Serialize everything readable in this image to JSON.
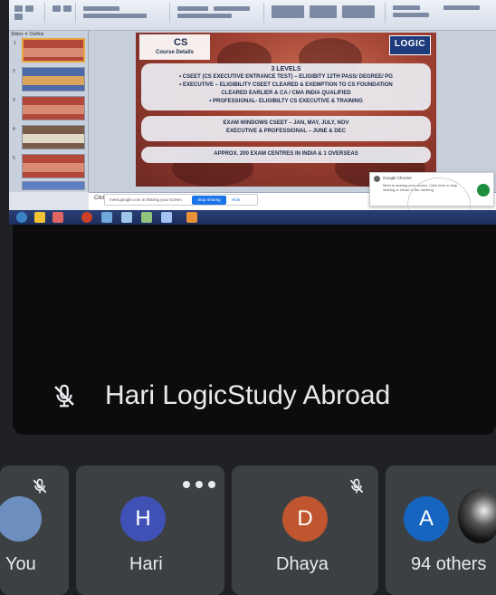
{
  "app": "Google Meet",
  "shared_screen": {
    "slide": {
      "title": "CS",
      "subtitle": "Course Details",
      "logo": "LOGIC",
      "levels_heading": "3 LEVELS",
      "levels": [
        "• CSEET (CS EXECUTIVE ENTRANCE TEST) – ELIGIBITY 12TH PASS/ DEGREE/ PG",
        "• EXECUTIVE – ELIGIBILITY CSEET CLEARED & EXEMPTION TO CS FOUNDATION",
        "CLEARED EARLIER & CA / CMA INDIA QUALIFIED",
        "• PROFESSIONAL- ELIGIBILTY CS EXECUTIVE & TRAINING"
      ],
      "exam_windows": [
        "EXAM WINDOWS CSEET – JAN, MAY, JULY, NOV",
        "EXECUTIVE & PROFESSIONAL – JUNE & DEC"
      ],
      "centres": "APPROX. 200 EXAM CENTRES IN INDIA & 1 OVERSEAS"
    },
    "notes_placeholder": "Click to add notes",
    "share_bar": {
      "text": "meet.google.com is sharing your screen.",
      "stop_label": "Stop sharing",
      "hide_label": "Hide"
    },
    "toast": {
      "title": "Google Chrome",
      "body": "Meet is sharing your screen. Click here to stop sharing or return to the meeting."
    },
    "colors": {
      "taskbar": "#1c2d5a",
      "slide_bg": "#9c3e30",
      "logo_bg": "#1d3a7a"
    }
  },
  "main_speaker": {
    "name": "Hari LogicStudy Abroad",
    "mic": "mic-off-icon"
  },
  "participants": [
    {
      "name": "You",
      "initial": "",
      "color": "#6d8fbf",
      "muted": true
    },
    {
      "name": "Hari",
      "initial": "H",
      "color": "#3f51b5",
      "muted": false
    },
    {
      "name": "Dhaya",
      "initial": "D",
      "color": "#c0562f",
      "muted": true
    },
    {
      "name": "94 others",
      "initial": "A",
      "color": "#1565c0",
      "muted": false
    }
  ]
}
